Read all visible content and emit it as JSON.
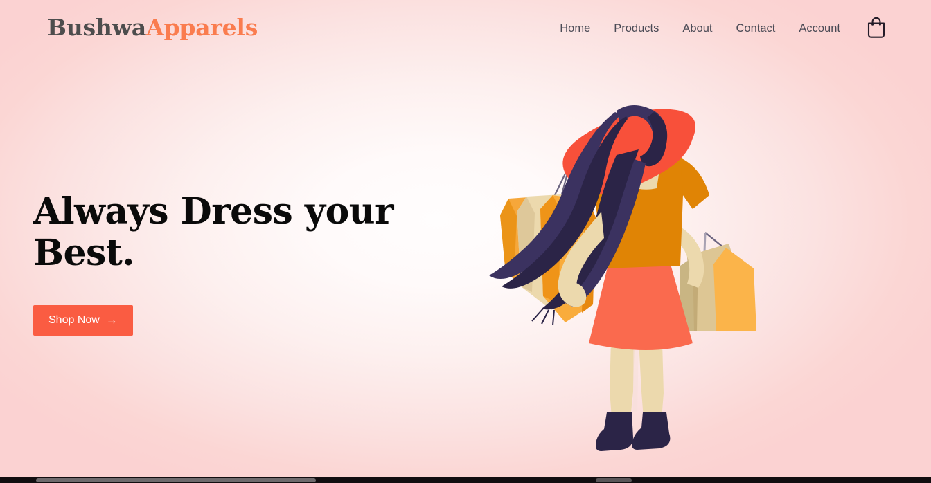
{
  "site": {
    "logo_primary": "Bushwa",
    "logo_accent": "Apparels",
    "brand_color": "#fa7c4e",
    "accent_color": "#fa5c42",
    "background_edge_color": "#fbd2d2",
    "background_center_color": "#fffdfd"
  },
  "nav": {
    "items": [
      {
        "label": "Home"
      },
      {
        "label": "Products"
      },
      {
        "label": "About"
      },
      {
        "label": "Contact"
      },
      {
        "label": "Account"
      }
    ],
    "cart_icon": "shopping-bag-icon"
  },
  "hero": {
    "headline": "Always Dress your\nBest.",
    "cta_label": "Shop Now",
    "cta_arrow": "→",
    "illustration": {
      "name": "woman-shopping-illustration",
      "colors": {
        "hat": "#f8503a",
        "hair": "#3b3260",
        "hair_dark": "#2b2447",
        "skin": "#ecd9ad",
        "top": "#e08405",
        "skirt": "#fa6a4e",
        "shoes": "#2b2447",
        "bag_orange": "#f9ac3c",
        "bag_amber": "#ef9418",
        "bag_cream": "#ecd9ad",
        "bag_khaki": "#c9b583",
        "handle": "#6b6480"
      }
    }
  },
  "browser": {
    "horizontal_scrollbar": "visible"
  }
}
